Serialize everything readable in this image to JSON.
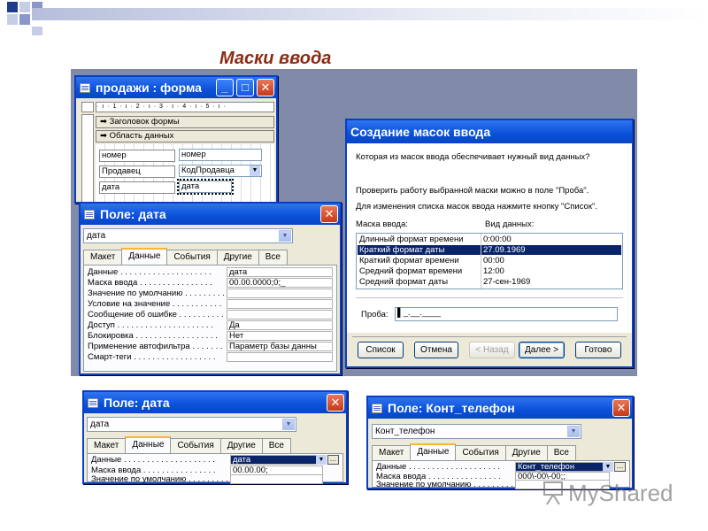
{
  "slide": {
    "title": "Маски ввода"
  },
  "colors": {
    "title": "#8b2a14",
    "titlebar": "#0a50d8",
    "selection": "#0a246a",
    "backdrop": "#7f8ba8"
  },
  "form_window": {
    "title": "продажи : форма",
    "ruler": "· ı · 1 · ı · 2 · ı · 3 · ı · 4 · ı · 5 · ı ·",
    "header_section": "Заголовок формы",
    "data_section": "Область данных",
    "fields": [
      {
        "label": "номер",
        "value": "номер"
      },
      {
        "label": "Продавец",
        "value": "КодПродавца"
      },
      {
        "label": "дата",
        "value": "дата"
      }
    ]
  },
  "prop_window_1": {
    "title": "Поле: дата",
    "object": "дата",
    "tabs": [
      "Макет",
      "Данные",
      "События",
      "Другие",
      "Все"
    ],
    "active_tab": "Данные",
    "rows": [
      {
        "label": "Данные . . . . . . . . . . . . . . . . . . . .",
        "value": "дата"
      },
      {
        "label": "Маска ввода . . . . . . . . . . . . . . . .",
        "value": "00.00.0000;0;_"
      },
      {
        "label": "Значение по умолчанию . . . . . . . . .",
        "value": ""
      },
      {
        "label": "Условие на значение . . . . . . . . . . .",
        "value": ""
      },
      {
        "label": "Сообщение об ошибке . . . . . . . . . .",
        "value": ""
      },
      {
        "label": "Доступ . . . . . . . . . . . . . . . . . . . . .",
        "value": "Да"
      },
      {
        "label": "Блокировка . . . . . . . . . . . . . . . . . .",
        "value": "Нет"
      },
      {
        "label": "Применение автофильтра . . . . . . . .",
        "value": "Параметр базы данны"
      },
      {
        "label": "Смарт-теги . . . . . . . . . . . . . . . . . .",
        "value": ""
      }
    ]
  },
  "wizard": {
    "title": "Создание масок ввода",
    "question": "Которая из масок ввода обеспечивает нужный вид данных?",
    "hint1": "Проверить работу выбранной маски можно в поле \"Проба\".",
    "hint2": "Для изменения списка масок ввода нажмите кнопку \"Список\".",
    "col_mask": "Маска ввода:",
    "col_view": "Вид данных:",
    "masks": [
      {
        "name": "Длинный формат времени",
        "view": "0:00:00"
      },
      {
        "name": "Краткий формат даты",
        "view": "27.09.1969"
      },
      {
        "name": "Краткий формат времени",
        "view": "00:00"
      },
      {
        "name": "Средний формат времени",
        "view": "12:00"
      },
      {
        "name": "Средний формат даты",
        "view": "27-сен-1969"
      }
    ],
    "trial_label": "Проба:",
    "trial_value": "▌_.__.____",
    "buttons": {
      "list": "Список",
      "cancel": "Отмена",
      "back": "< Назад",
      "next": "Далее >",
      "finish": "Готово"
    }
  },
  "prop_window_2": {
    "title": "Поле: дата",
    "object": "дата",
    "tabs": [
      "Макет",
      "Данные",
      "События",
      "Другие",
      "Все"
    ],
    "active_tab": "Данные",
    "rows": [
      {
        "label": "Данные . . . . . . . . . . . . . . . . . . . .",
        "value": "дата"
      },
      {
        "label": "Маска ввода . . . . . . . . . . . . . . . .",
        "value": "00.00.00;"
      },
      {
        "label": "Значение по умолчанию . . . . . . . . .",
        "value": ""
      }
    ]
  },
  "prop_window_3": {
    "title": "Поле: Конт_телефон",
    "object": "Конт_телефон",
    "tabs": [
      "Макет",
      "Данные",
      "События",
      "Другие",
      "Все"
    ],
    "active_tab": "Данные",
    "rows": [
      {
        "label": "Данные . . . . . . . . . . . . . . . . . . . .",
        "value": "Конт_телефон"
      },
      {
        "label": "Маска ввода . . . . . . . . . . . . . . . .",
        "value": "000\\-00\\-00;;_"
      },
      {
        "label": "Значение по умолчанию . . . . . . . . .",
        "value": ""
      }
    ]
  },
  "watermark": {
    "text": "MyShared"
  }
}
